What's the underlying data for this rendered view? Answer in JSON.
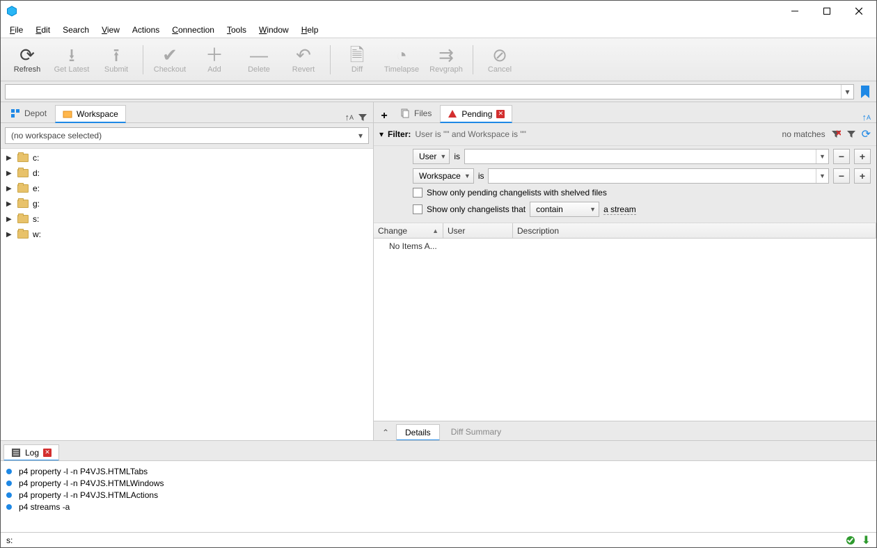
{
  "menu": {
    "file": "File",
    "edit": "Edit",
    "search": "Search",
    "view": "View",
    "actions": "Actions",
    "connection": "Connection",
    "tools": "Tools",
    "window": "Window",
    "help": "Help"
  },
  "toolbar": {
    "refresh": "Refresh",
    "get_latest": "Get Latest",
    "submit": "Submit",
    "checkout": "Checkout",
    "add": "Add",
    "delete": "Delete",
    "revert": "Revert",
    "diff": "Diff",
    "timelapse": "Timelapse",
    "revgraph": "Revgraph",
    "cancel": "Cancel"
  },
  "left_tabs": {
    "depot": "Depot",
    "workspace": "Workspace"
  },
  "right_tabs": {
    "files": "Files",
    "pending": "Pending"
  },
  "workspace_selector": "(no workspace selected)",
  "drives": [
    "c:",
    "d:",
    "e:",
    "g:",
    "s:",
    "w:"
  ],
  "filter": {
    "label": "Filter:",
    "desc": "User is \"\" and Workspace is \"\"",
    "no_matches": "no matches",
    "user_label": "User",
    "workspace_label": "Workspace",
    "is": "is",
    "shelved": "Show only pending changelists with shelved files",
    "that": "Show only changelists that",
    "contain": "contain",
    "a_stream": "a stream"
  },
  "grid": {
    "cols": {
      "change": "Change",
      "user": "User",
      "description": "Description"
    },
    "empty": "No Items A..."
  },
  "bottom_tabs": {
    "details": "Details",
    "diff_summary": "Diff Summary"
  },
  "log": {
    "tab": "Log",
    "lines": [
      "p4 property -l -n P4VJS.HTMLTabs",
      "p4 property -l -n P4VJS.HTMLWindows",
      "p4 property -l -n P4VJS.HTMLActions",
      "p4 streams -a"
    ]
  },
  "status_text": "s:"
}
